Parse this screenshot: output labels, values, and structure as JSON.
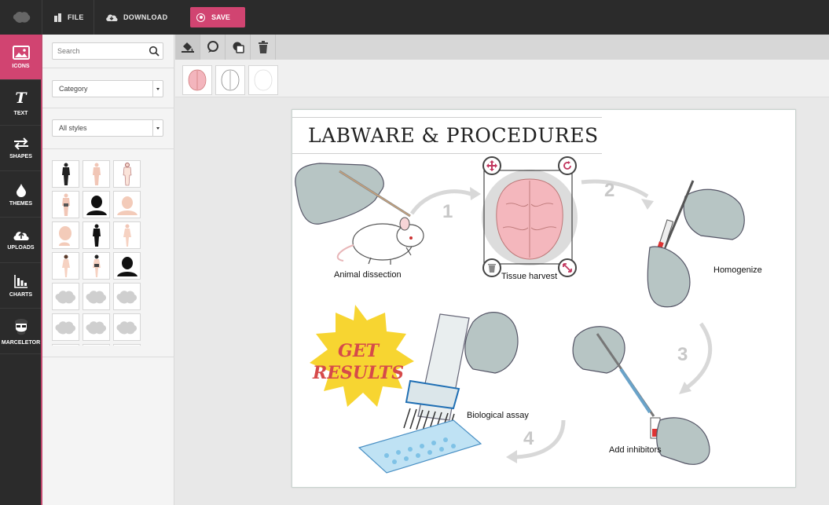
{
  "topbar": {
    "file_label": "FILE",
    "download_label": "DOWNLOAD",
    "save_label": "SAVE"
  },
  "sidebar": {
    "items": [
      {
        "label": "ICONS",
        "icon": "image-icon"
      },
      {
        "label": "TEXT",
        "icon": "text-icon"
      },
      {
        "label": "SHAPES",
        "icon": "arrows-icon"
      },
      {
        "label": "THEMES",
        "icon": "drop-icon"
      },
      {
        "label": "UPLOADS",
        "icon": "cloud-upload-icon"
      },
      {
        "label": "CHARTS",
        "icon": "bar-chart-icon"
      },
      {
        "label": "MARCELETOR",
        "icon": "avatar-icon"
      }
    ]
  },
  "panel": {
    "search_placeholder": "Search",
    "category_value": "Category",
    "styles_value": "All styles"
  },
  "canvas": {
    "title": "LABWARE & PROCEDURES",
    "labels": {
      "animal": "Animal dissection",
      "tissue": "Tissue harvest",
      "homogenize": "Homogenize",
      "inhibitors": "Add inhibitors",
      "assay": "Biological assay"
    },
    "steps": [
      "1",
      "2",
      "3",
      "4"
    ],
    "burst_line1": "GET",
    "burst_line2": "RESULTS"
  },
  "colors": {
    "accent": "#d14471",
    "dark": "#2b2b2b",
    "burst": "#f7d531"
  }
}
